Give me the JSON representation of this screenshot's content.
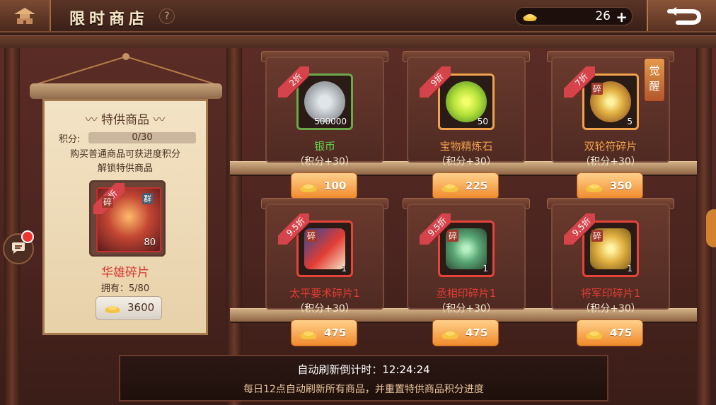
{
  "header": {
    "title": "限时商店",
    "help_label": "?",
    "currency_amount": "26",
    "currency_plus": "+",
    "currency_icon": "gold-ingot"
  },
  "special_panel": {
    "title": "特供商品",
    "score_label": "积分:",
    "score_value": "0/30",
    "score_progress": 0.0,
    "description_line1": "购买普通商品可获进度积分",
    "description_line2": "解锁特供商品",
    "item": {
      "discount": "9折",
      "badge_fragment": "碎",
      "badge_group": "群",
      "count": "80",
      "name": "华雄碎片",
      "owned_label": "拥有：5/80",
      "price": "3600"
    }
  },
  "awaken_label_1": "觉",
  "awaken_label_2": "醒",
  "shop_items": [
    {
      "discount": "2折",
      "name": "银币",
      "name_color": "#62d24b",
      "count": "500000",
      "points": "（积分+30）",
      "price": "100",
      "border": "green"
    },
    {
      "discount": "9折",
      "name": "宝物精炼石",
      "name_color": "#f0a04a",
      "count": "50",
      "points": "（积分+30）",
      "price": "225",
      "border": "orange"
    },
    {
      "discount": "7折",
      "name": "双轮符碎片",
      "name_color": "#f0a04a",
      "count": "5",
      "points": "（积分+30）",
      "price": "350",
      "border": "orange",
      "fragment": "碎"
    },
    {
      "discount": "9.5折",
      "name": "太平要术碎片1",
      "name_color": "#e23c34",
      "count": "1",
      "points": "（积分+30）",
      "price": "475",
      "border": "red",
      "fragment": "碎"
    },
    {
      "discount": "9.5折",
      "name": "丞相印碎片1",
      "name_color": "#e23c34",
      "count": "1",
      "points": "（积分+30）",
      "price": "475",
      "border": "red",
      "fragment": "碎"
    },
    {
      "discount": "9.5折",
      "name": "将军印碎片1",
      "name_color": "#e23c34",
      "count": "1",
      "points": "（积分+30）",
      "price": "475",
      "border": "red",
      "fragment": "碎"
    }
  ],
  "bottom": {
    "refresh_label": "自动刷新倒计时：12:24:24",
    "refresh_note": "每日12点自动刷新所有商品，并重置特供商品积分进度"
  },
  "colors": {
    "accent_orange": "#f08a2b",
    "discount_ribbon": "#d7434a"
  }
}
